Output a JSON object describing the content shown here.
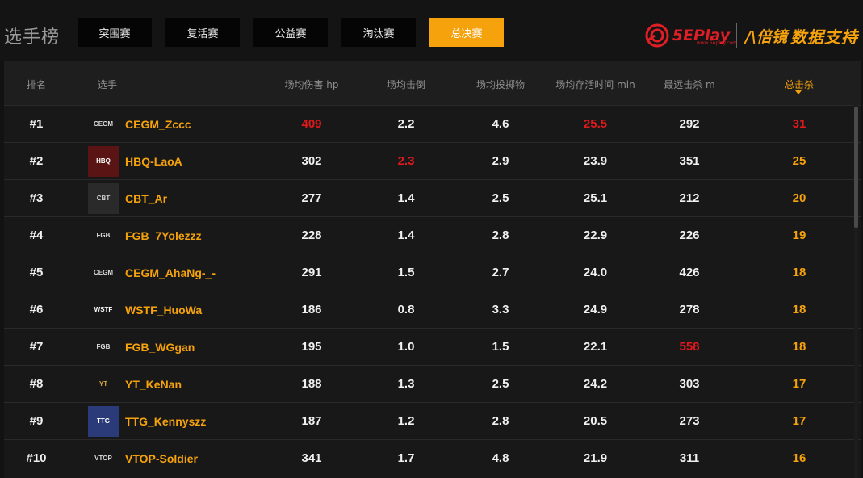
{
  "header": {
    "title": "选手榜",
    "tabs": [
      {
        "label": "突围赛",
        "active": false
      },
      {
        "label": "复活赛",
        "active": false
      },
      {
        "label": "公益赛",
        "active": false
      },
      {
        "label": "淘汰赛",
        "active": false
      },
      {
        "label": "总决赛",
        "active": true
      }
    ],
    "brand_logo_text": "5EPlay",
    "brand_logo_sub": "www.5eplay.com",
    "brand_partner_mark": "/\\倍镜",
    "brand_partner_text": "数据支持"
  },
  "colors": {
    "accent": "#f5a20c",
    "highlight": "#e0191d",
    "background": "#121212"
  },
  "table": {
    "columns": [
      "排名",
      "选手",
      "场均伤害 hp",
      "场均击倒",
      "场均投掷物",
      "场均存活时间 min",
      "最远击杀 m",
      "总击杀"
    ],
    "sorted_column": "总击杀",
    "rows": [
      {
        "rank": "#1",
        "team_logo": "CEGM",
        "player": "CEGM_Zccc",
        "dmg": "409",
        "knocks": "2.2",
        "throws": "4.6",
        "survive": "25.5",
        "dist": "292",
        "kills": "31"
      },
      {
        "rank": "#2",
        "team_logo": "HBQ",
        "player": "HBQ-LaoA",
        "dmg": "302",
        "knocks": "2.3",
        "throws": "2.9",
        "survive": "23.9",
        "dist": "351",
        "kills": "25"
      },
      {
        "rank": "#3",
        "team_logo": "CBT",
        "player": "CBT_Ar",
        "dmg": "277",
        "knocks": "1.4",
        "throws": "2.5",
        "survive": "25.1",
        "dist": "212",
        "kills": "20"
      },
      {
        "rank": "#4",
        "team_logo": "FGB",
        "player": "FGB_7Yolezzz",
        "dmg": "228",
        "knocks": "1.4",
        "throws": "2.8",
        "survive": "22.9",
        "dist": "226",
        "kills": "19"
      },
      {
        "rank": "#5",
        "team_logo": "CEGM",
        "player": "CEGM_AhaNg-_-",
        "dmg": "291",
        "knocks": "1.5",
        "throws": "2.7",
        "survive": "24.0",
        "dist": "426",
        "kills": "18"
      },
      {
        "rank": "#6",
        "team_logo": "WSTF",
        "player": "WSTF_HuoWa",
        "dmg": "186",
        "knocks": "0.8",
        "throws": "3.3",
        "survive": "24.9",
        "dist": "278",
        "kills": "18"
      },
      {
        "rank": "#7",
        "team_logo": "FGB",
        "player": "FGB_WGgan",
        "dmg": "195",
        "knocks": "1.0",
        "throws": "1.5",
        "survive": "22.1",
        "dist": "558",
        "kills": "18"
      },
      {
        "rank": "#8",
        "team_logo": "YT",
        "player": "YT_KeNan",
        "dmg": "188",
        "knocks": "1.3",
        "throws": "2.5",
        "survive": "24.2",
        "dist": "303",
        "kills": "17"
      },
      {
        "rank": "#9",
        "team_logo": "TTG",
        "player": "TTG_Kennyszz",
        "dmg": "187",
        "knocks": "1.2",
        "throws": "2.8",
        "survive": "20.5",
        "dist": "273",
        "kills": "17"
      },
      {
        "rank": "#10",
        "team_logo": "VTOP",
        "player": "VTOP-Soldier",
        "dmg": "341",
        "knocks": "1.7",
        "throws": "4.8",
        "survive": "21.9",
        "dist": "311",
        "kills": "16"
      }
    ]
  }
}
